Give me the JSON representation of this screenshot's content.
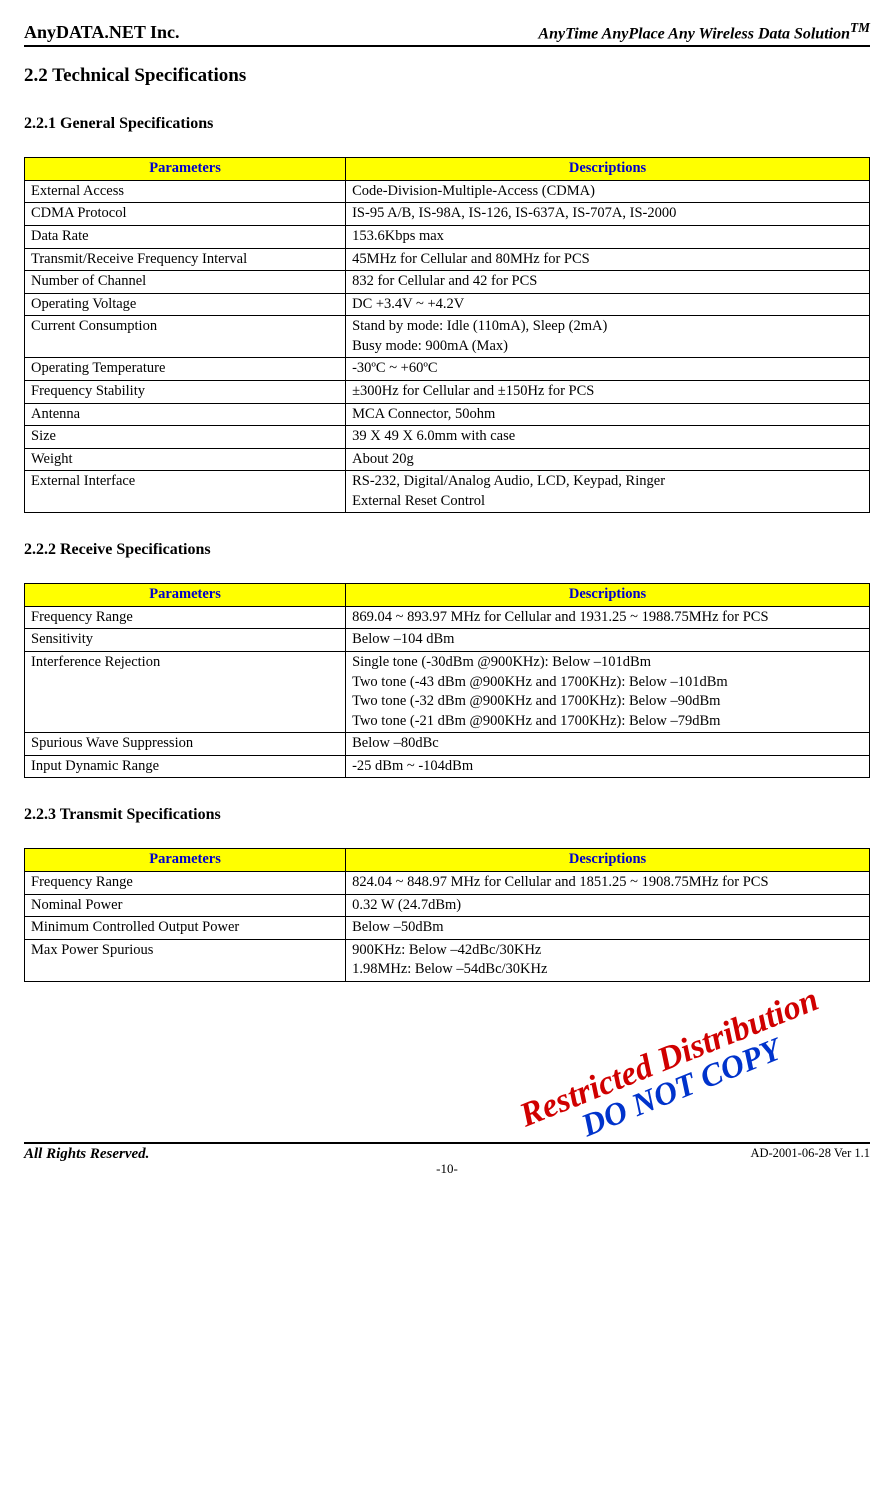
{
  "header": {
    "left": "AnyDATA.NET Inc.",
    "right_prefix": "AnyTime AnyPlace Any Wireless Data Solution",
    "right_sup": "TM"
  },
  "section_title": "2.2 Technical Specifications",
  "sub1_title": "2.2.1 General Specifications",
  "table_headers": {
    "param": "Parameters",
    "desc": "Descriptions"
  },
  "general": [
    {
      "p": "External Access",
      "d": "Code-Division-Multiple-Access (CDMA)"
    },
    {
      "p": "CDMA Protocol",
      "d": "IS-95 A/B, IS-98A, IS-126, IS-637A, IS-707A, IS-2000"
    },
    {
      "p": "Data Rate",
      "d": "153.6Kbps max"
    },
    {
      "p": "Transmit/Receive Frequency Interval",
      "d": "45MHz for Cellular and 80MHz for PCS"
    },
    {
      "p": "Number of Channel",
      "d": "832 for Cellular and 42 for PCS"
    },
    {
      "p": "Operating Voltage",
      "d": "DC    +3.4V ~ +4.2V"
    },
    {
      "p": "Current Consumption",
      "d": "Stand by mode: Idle (110mA),    Sleep (2mA)\nBusy mode: 900mA (Max)"
    },
    {
      "p": "Operating Temperature",
      "d": "-30ºC ~ +60ºC"
    },
    {
      "p": "Frequency Stability",
      "d": "±300Hz for Cellular and ±150Hz for PCS"
    },
    {
      "p": "Antenna",
      "d": "MCA Connector, 50ohm"
    },
    {
      "p": "Size",
      "d": "39 X 49 X 6.0mm with case"
    },
    {
      "p": "Weight",
      "d": "About 20g"
    },
    {
      "p": "External Interface",
      "d": "RS-232, Digital/Analog Audio, LCD, Keypad, Ringer\nExternal Reset Control"
    }
  ],
  "sub2_title": "2.2.2 Receive Specifications",
  "receive": [
    {
      "p": "Frequency Range",
      "d": "869.04 ~ 893.97 MHz for Cellular and 1931.25 ~ 1988.75MHz for PCS"
    },
    {
      "p": "Sensitivity",
      "d": "Below –104 dBm"
    },
    {
      "p": "Interference Rejection",
      "d": "Single tone (-30dBm @900KHz): Below –101dBm\nTwo tone (-43 dBm @900KHz and 1700KHz): Below –101dBm\nTwo tone (-32 dBm @900KHz and 1700KHz): Below –90dBm\nTwo tone (-21 dBm @900KHz and 1700KHz): Below –79dBm"
    },
    {
      "p": "Spurious Wave Suppression",
      "d": "Below –80dBc"
    },
    {
      "p": "Input Dynamic Range",
      "d": "-25 dBm    ~    -104dBm"
    }
  ],
  "sub3_title": "2.2.3 Transmit Specifications",
  "transmit": [
    {
      "p": "Frequency Range",
      "d": "824.04 ~ 848.97 MHz for Cellular and 1851.25 ~ 1908.75MHz for PCS"
    },
    {
      "p": "Nominal Power",
      "d": "0.32 W (24.7dBm)"
    },
    {
      "p": "Minimum Controlled Output Power",
      "d": "Below –50dBm"
    },
    {
      "p": "Max Power Spurious",
      "d": "900KHz: Below –42dBc/30KHz\n1.98MHz: Below –54dBc/30KHz"
    }
  ],
  "watermark": {
    "line1": "Restricted Distribution",
    "line2": "DO NOT COPY"
  },
  "footer": {
    "left": "All Rights Reserved.",
    "right": "AD-2001-06-28 Ver 1.1",
    "page": "-10-"
  }
}
